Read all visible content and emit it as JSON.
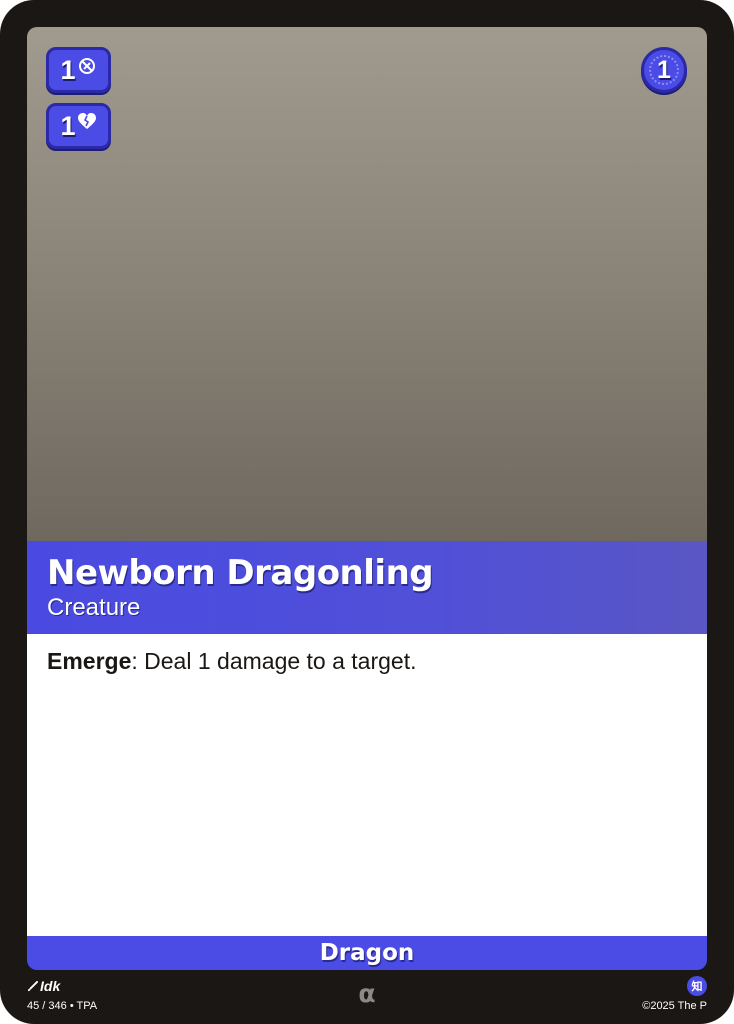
{
  "card": {
    "name": "Newborn Dragonling",
    "type": "Creature",
    "subtype": "Dragon",
    "cost": "1",
    "attack": "1",
    "health": "1",
    "attack_icon": "no-sword-icon",
    "health_icon": "broken-heart-icon",
    "rules": {
      "keyword": "Emerge",
      "separator": ":",
      "text": " Deal 1 damage to a target."
    }
  },
  "footer": {
    "artist": "Idk",
    "collector_info": "45 / 346 • TPA",
    "rarity_symbol": "α",
    "set_symbol": "知",
    "copyright": "©2025 The P"
  },
  "colors": {
    "accent": "#4b4be6",
    "frame": "#1a1714",
    "art_top": "#a09a8f",
    "art_bottom": "#6e685e"
  }
}
